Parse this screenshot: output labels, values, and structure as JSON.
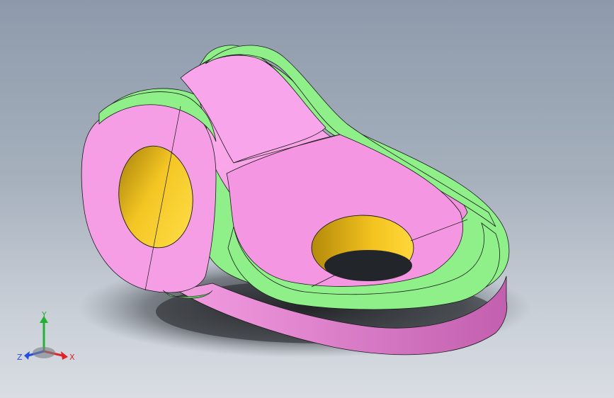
{
  "viewport": {
    "background_top": "#8e9aab",
    "background_bottom": "#d9dde3"
  },
  "model": {
    "colors": {
      "body": "#f59ee6",
      "body_shade": "#d774c6",
      "flange": "#8ff08a",
      "flange_shade": "#5fc45a",
      "bore": "#f2c21a",
      "bore_shade": "#9b7400",
      "edge": "#1a1a1a"
    }
  },
  "triad": {
    "x_label": "X",
    "y_label": "Y",
    "z_label": "Z",
    "colors": {
      "x": "#e0232a",
      "y": "#1fb32e",
      "z": "#2a4be0"
    }
  }
}
